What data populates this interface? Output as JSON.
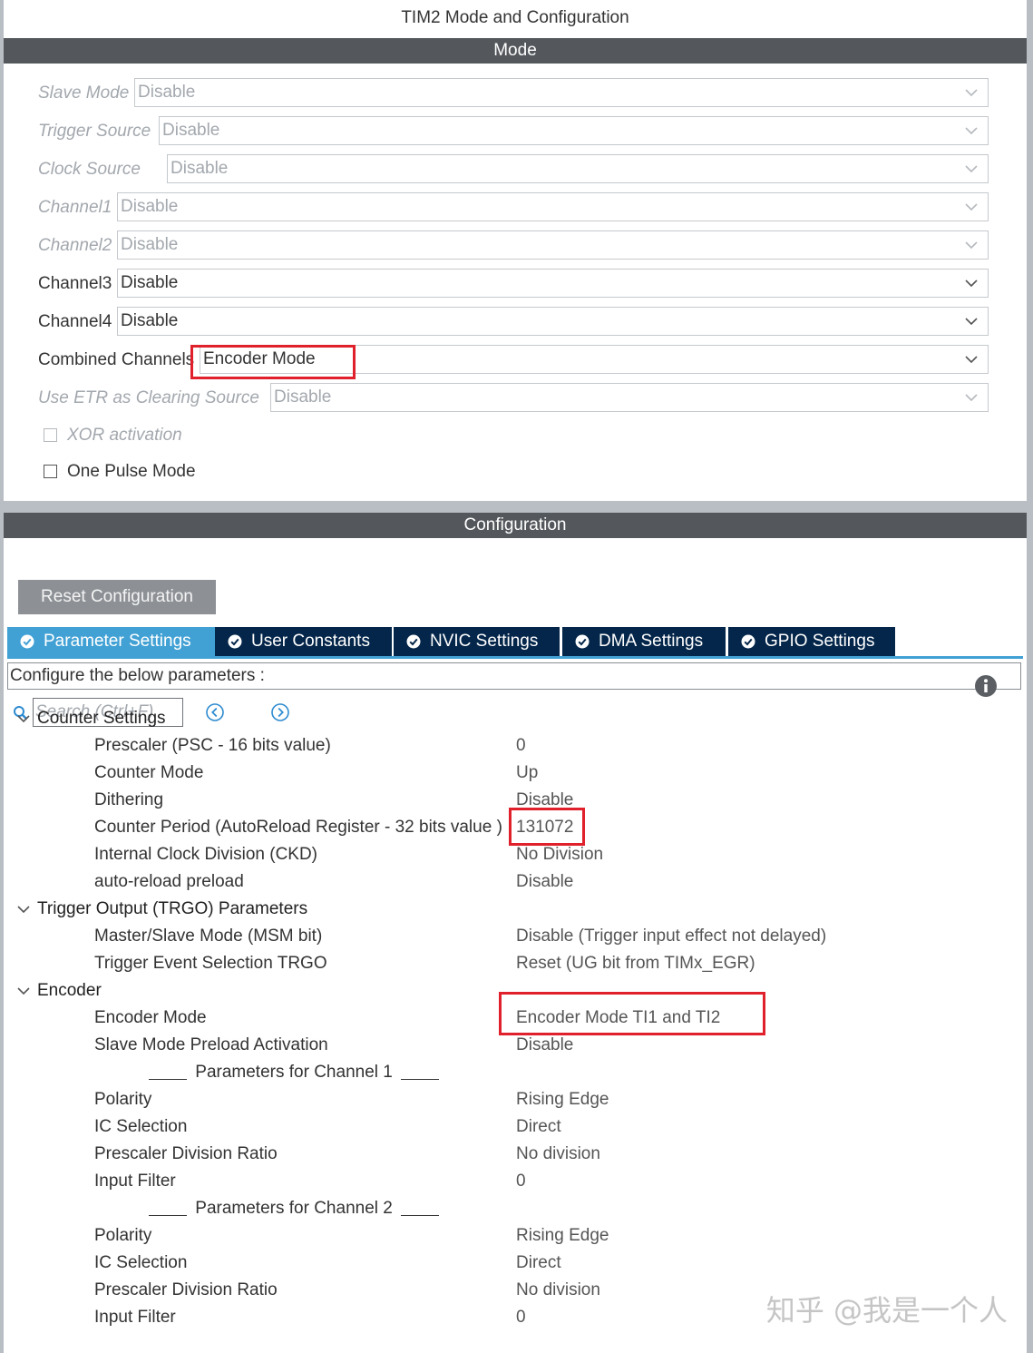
{
  "window_title": "TIM2 Mode and Configuration",
  "mode_header": "Mode",
  "mode_fields": [
    {
      "label": "Slave Mode",
      "value": "Disable",
      "enabled": false
    },
    {
      "label": "Trigger Source",
      "value": "Disable",
      "enabled": false
    },
    {
      "label": "Clock Source",
      "value": "Disable",
      "enabled": false
    },
    {
      "label": "Channel1",
      "value": "Disable",
      "enabled": false
    },
    {
      "label": "Channel2",
      "value": "Disable",
      "enabled": false
    },
    {
      "label": "Channel3",
      "value": "Disable",
      "enabled": true
    },
    {
      "label": "Channel4",
      "value": "Disable",
      "enabled": true
    },
    {
      "label": "Combined Channels",
      "value": "Encoder Mode",
      "enabled": true
    },
    {
      "label": "Use ETR as Clearing Source",
      "value": "Disable",
      "enabled": false
    }
  ],
  "checkboxes": [
    {
      "label": "XOR activation",
      "checked": false,
      "enabled": false
    },
    {
      "label": "One Pulse Mode",
      "checked": false,
      "enabled": true
    }
  ],
  "config_header": "Configuration",
  "reset_button": "Reset Configuration",
  "tabs": [
    {
      "label": "Parameter Settings",
      "active": true
    },
    {
      "label": "User Constants",
      "active": false
    },
    {
      "label": "NVIC Settings",
      "active": false
    },
    {
      "label": "DMA Settings",
      "active": false
    },
    {
      "label": "GPIO Settings",
      "active": false
    }
  ],
  "config_prompt": "Configure the below parameters :",
  "search": {
    "placeholder": "Search (Ctrl+F)",
    "icon": "search-icon"
  },
  "groups": [
    {
      "name": "Counter Settings",
      "params": [
        {
          "name": "Prescaler (PSC - 16 bits value)",
          "value": "0"
        },
        {
          "name": "Counter Mode",
          "value": "Up"
        },
        {
          "name": "Dithering",
          "value": "Disable"
        },
        {
          "name": "Counter Period (AutoReload Register - 32 bits value )",
          "value": "131072"
        },
        {
          "name": "Internal Clock Division (CKD)",
          "value": "No Division"
        },
        {
          "name": "auto-reload preload",
          "value": "Disable"
        }
      ]
    },
    {
      "name": "Trigger Output (TRGO) Parameters",
      "params": [
        {
          "name": "Master/Slave Mode (MSM bit)",
          "value": "Disable (Trigger input effect not delayed)"
        },
        {
          "name": "Trigger Event Selection TRGO",
          "value": "Reset (UG bit from TIMx_EGR)"
        }
      ]
    },
    {
      "name": "Encoder",
      "params": [
        {
          "name": "Encoder Mode",
          "value": "Encoder Mode TI1 and TI2"
        },
        {
          "name": "Slave Mode Preload Activation",
          "value": "Disable"
        }
      ],
      "channel_1": {
        "title": "Parameters for Channel 1",
        "params": [
          {
            "name": "Polarity",
            "value": "Rising Edge"
          },
          {
            "name": "IC Selection",
            "value": "Direct"
          },
          {
            "name": "Prescaler Division Ratio",
            "value": "No division"
          },
          {
            "name": "Input Filter",
            "value": "0"
          }
        ]
      },
      "channel_2": {
        "title": "Parameters for Channel 2",
        "params": [
          {
            "name": "Polarity",
            "value": "Rising Edge"
          },
          {
            "name": "IC Selection",
            "value": "Direct"
          },
          {
            "name": "Prescaler Division Ratio",
            "value": "No division"
          },
          {
            "name": "Input Filter",
            "value": "0"
          }
        ]
      }
    }
  ],
  "watermark": "知乎 @我是一个人",
  "colors": {
    "header_bar": "#54585d",
    "active_tab": "#41a1d4",
    "tab": "#04264a",
    "highlight": "#e0202a"
  }
}
